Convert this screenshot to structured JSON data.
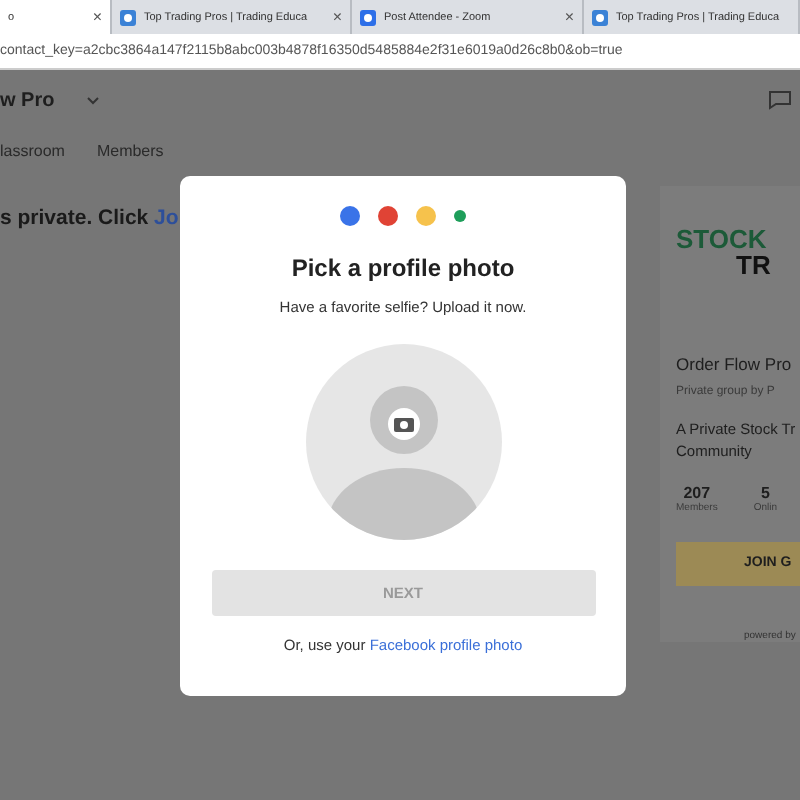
{
  "browser": {
    "tabs": [
      {
        "title": "o",
        "selected": true,
        "close": "×"
      },
      {
        "title": "Top Trading Pros | Trading Educa",
        "selected": false,
        "close": "×"
      },
      {
        "title": "Post Attendee - Zoom",
        "selected": false,
        "close": "×"
      },
      {
        "title": "Top Trading Pros | Trading Educa",
        "selected": false
      }
    ],
    "address": "contact_key=a2cbc3864a147f2115b8abc003b4878f16350d5485884e2f31e6019a0d26c8b0&ob=true"
  },
  "page": {
    "group_title": "w Pro",
    "nav": [
      {
        "label": "lassroom",
        "selected": false
      },
      {
        "label": "Members",
        "selected": false
      }
    ],
    "notice": {
      "text": "s private. Click ",
      "link": "Jo"
    },
    "card": {
      "logo_top": "STOCK",
      "logo_bottom": "TR",
      "name": "Order Flow Pro",
      "privacy": "Private group by P",
      "description": "A Private Stock Tr Community",
      "stats": [
        {
          "value": "207",
          "label": "Members"
        },
        {
          "value": "5",
          "label": "Onlin"
        }
      ],
      "join": "JOIN G",
      "powered": "powered by"
    }
  },
  "dialog": {
    "dots": [
      {
        "color": "#3a73e8"
      },
      {
        "color": "#e04335"
      },
      {
        "color": "#f6c24c"
      },
      {
        "color": "#1e9e5a"
      }
    ],
    "title": "Pick a profile photo",
    "subtitle": "Have a favorite selfie? Upload it now.",
    "next": {
      "label": "NEXT",
      "disabled": true
    },
    "alt_text": "Or, use your ",
    "alt_link": "Facebook profile photo"
  }
}
